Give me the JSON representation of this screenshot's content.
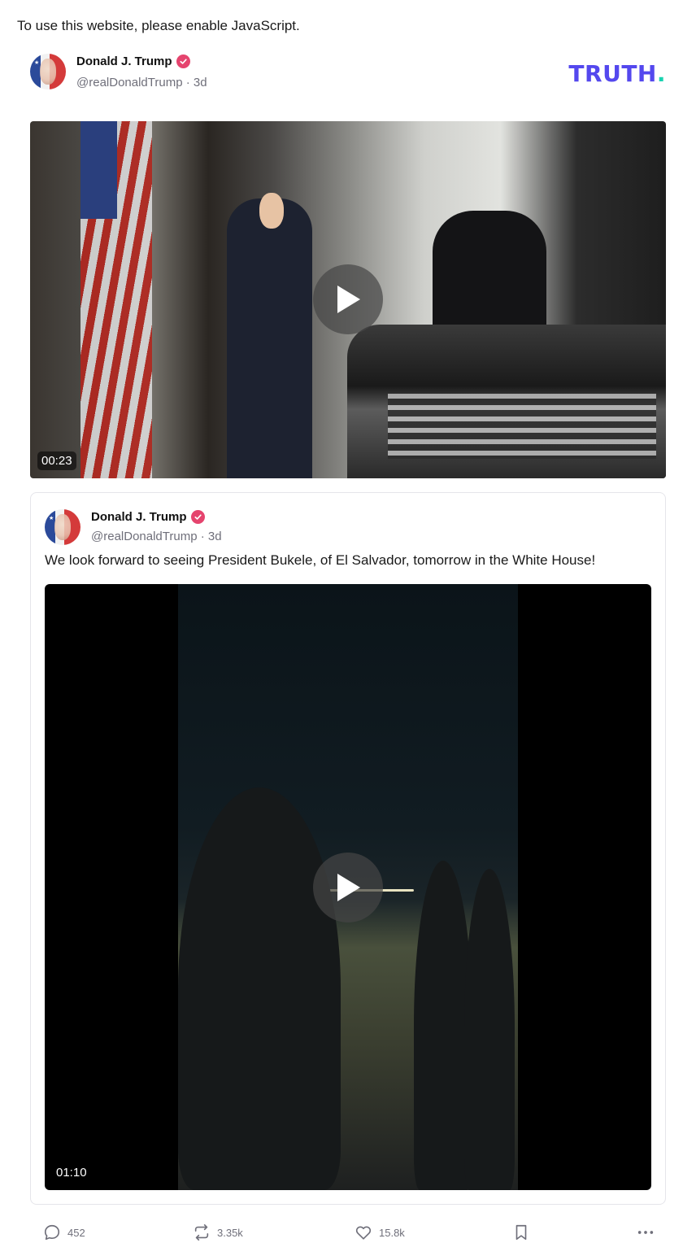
{
  "noscript_message": "To use this website, please enable JavaScript.",
  "brand": {
    "logo_text": "TRUTH",
    "logo_dot": ".",
    "logo_color": "#5448ee",
    "logo_dot_color": "#19d3b0"
  },
  "post": {
    "author_name": "Donald J. Trump",
    "handle": "@realDonaldTrump",
    "age": "3d",
    "video": {
      "duration": "00:23"
    }
  },
  "quoted_post": {
    "author_name": "Donald J. Trump",
    "handle": "@realDonaldTrump",
    "age": "3d",
    "text": "We look forward to seeing President Bukele, of El Salvador, tomorrow in the White House!",
    "video": {
      "duration": "01:10"
    }
  },
  "actions": {
    "replies": "452",
    "retruths": "3.35k",
    "likes": "15.8k"
  },
  "icons": [
    "verified-badge-icon",
    "play-icon",
    "reply-icon",
    "retruth-icon",
    "like-icon",
    "bookmark-icon",
    "more-icon"
  ],
  "colors": {
    "verified": "#e5446e",
    "muted_text": "#6f6f7a"
  }
}
